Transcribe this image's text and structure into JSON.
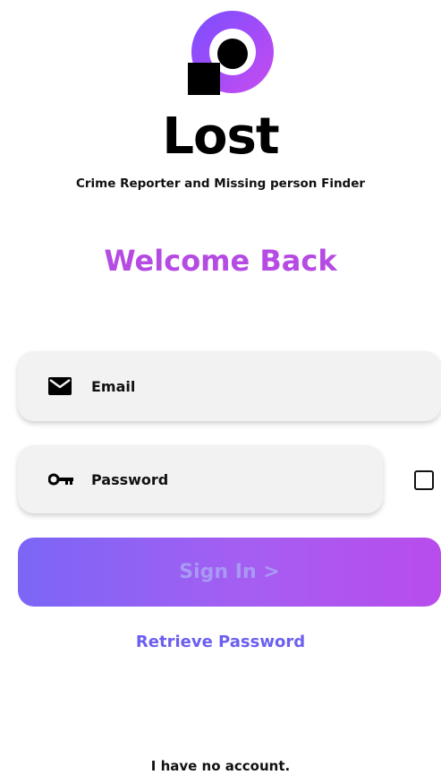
{
  "app": {
    "name": "Lost",
    "tagline": "Crime Reporter and Missing person Finder"
  },
  "heading": "Welcome Back",
  "form": {
    "email": {
      "placeholder": "Email",
      "icon": "mail-icon"
    },
    "password": {
      "placeholder": "Password",
      "icon": "key-icon"
    },
    "show_password_checkbox": {
      "checked": false
    }
  },
  "actions": {
    "sign_in_label": "Sign In  >",
    "retrieve_password_label": "Retrieve Password",
    "no_account_label": "I have no account."
  },
  "colors": {
    "heading": "#b54be3",
    "button_gradient_start": "#7b66f6",
    "button_gradient_end": "#b84cec",
    "link": "#6b5ff0",
    "field_bg": "#f2f2f2"
  }
}
